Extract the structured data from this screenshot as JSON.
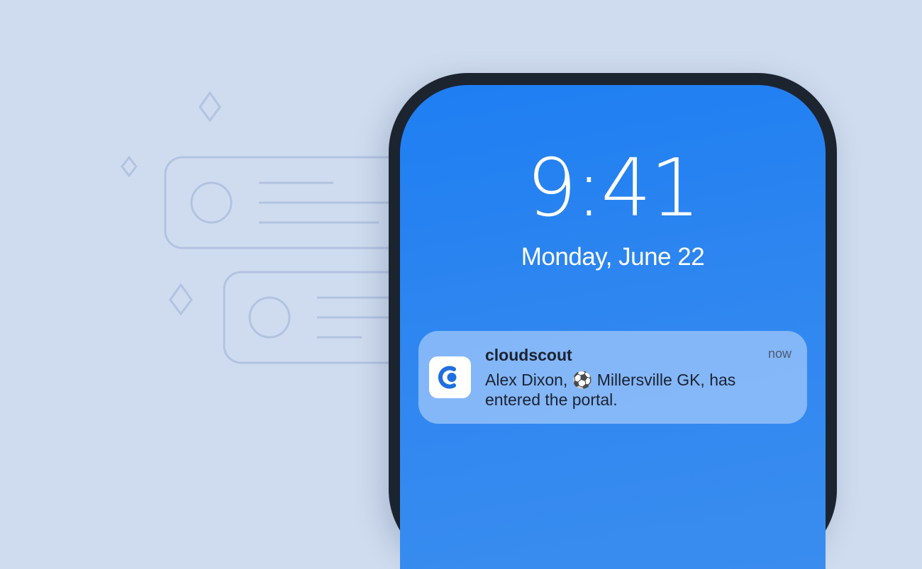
{
  "lockscreen": {
    "time": "9:41",
    "date": "Monday, June 22"
  },
  "notification": {
    "app_name": "cloudscout",
    "time": "now",
    "message": "Alex Dixon, ⚽ Millersville GK, has entered the portal.",
    "icon": "cloudscout-logo-icon"
  },
  "colors": {
    "background": "#cfdcef",
    "phone_frame": "#1c2430",
    "screen": "#2e86f0",
    "brand": "#1f6fe0"
  }
}
